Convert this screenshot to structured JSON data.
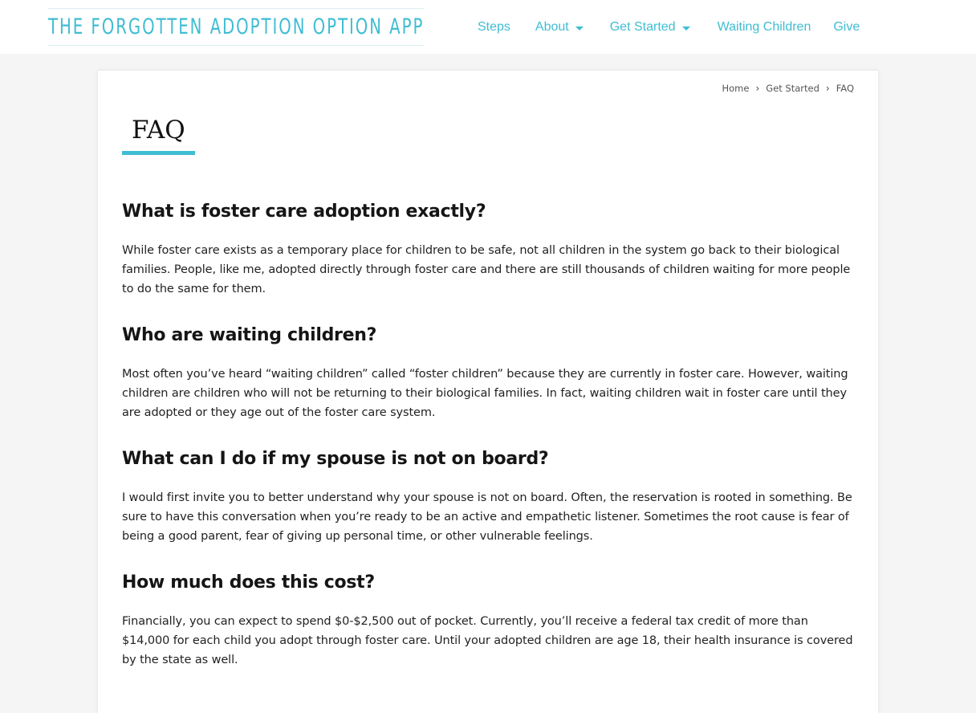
{
  "header": {
    "logo_text": "THE FORGOTTEN ADOPTION OPTION APP",
    "nav": [
      {
        "label": "Steps"
      },
      {
        "label": "About"
      },
      {
        "label": "Get Started"
      },
      {
        "label": "Waiting Children"
      },
      {
        "label": "Give"
      }
    ]
  },
  "breadcrumb": [
    "Home",
    "Get Started",
    "FAQ"
  ],
  "page_title": "FAQ",
  "faq": [
    {
      "question": "What is foster care adoption exactly?",
      "answer": "While foster care exists as a temporary place for children to be safe, not all children in the system go back to their biological families. People, like me, adopted directly through foster care and there are still thousands of children waiting for more people to do the same for them."
    },
    {
      "question": "Who are waiting children?",
      "answer": "Most often you’ve heard “waiting children” called “foster children” because they are currently in foster care. However, waiting children are children who will not be returning to their biological families. In fact, waiting children wait in foster care until they are adopted or they age out of the foster care system."
    },
    {
      "question": "What can I do if my spouse is not on board?",
      "answer": "I would first invite you to better understand why your spouse is not on board. Often, the reservation is rooted in something. Be sure to have this conversation when you’re ready to be an active and empathetic listener. Sometimes the root cause is fear of being a good parent, fear of giving up personal time, or other vulnerable feelings."
    },
    {
      "question": "How much does this cost?",
      "answer": "Financially, you can expect to spend $0-$2,500 out of pocket. Currently, you’ll receive a federal tax credit of more than $14,000 for each child you adopt through foster care. Until your adopted children are age 18, their health insurance is covered by the state as well."
    }
  ],
  "colors": {
    "accent": "#3fbdd3",
    "background": "#f5f5f5",
    "card": "#ffffff",
    "text": "#1e1e1e"
  },
  "icons": {
    "nav_dropdown": "caret-down-icon",
    "breadcrumb_separator": "chevron-right-icon"
  }
}
